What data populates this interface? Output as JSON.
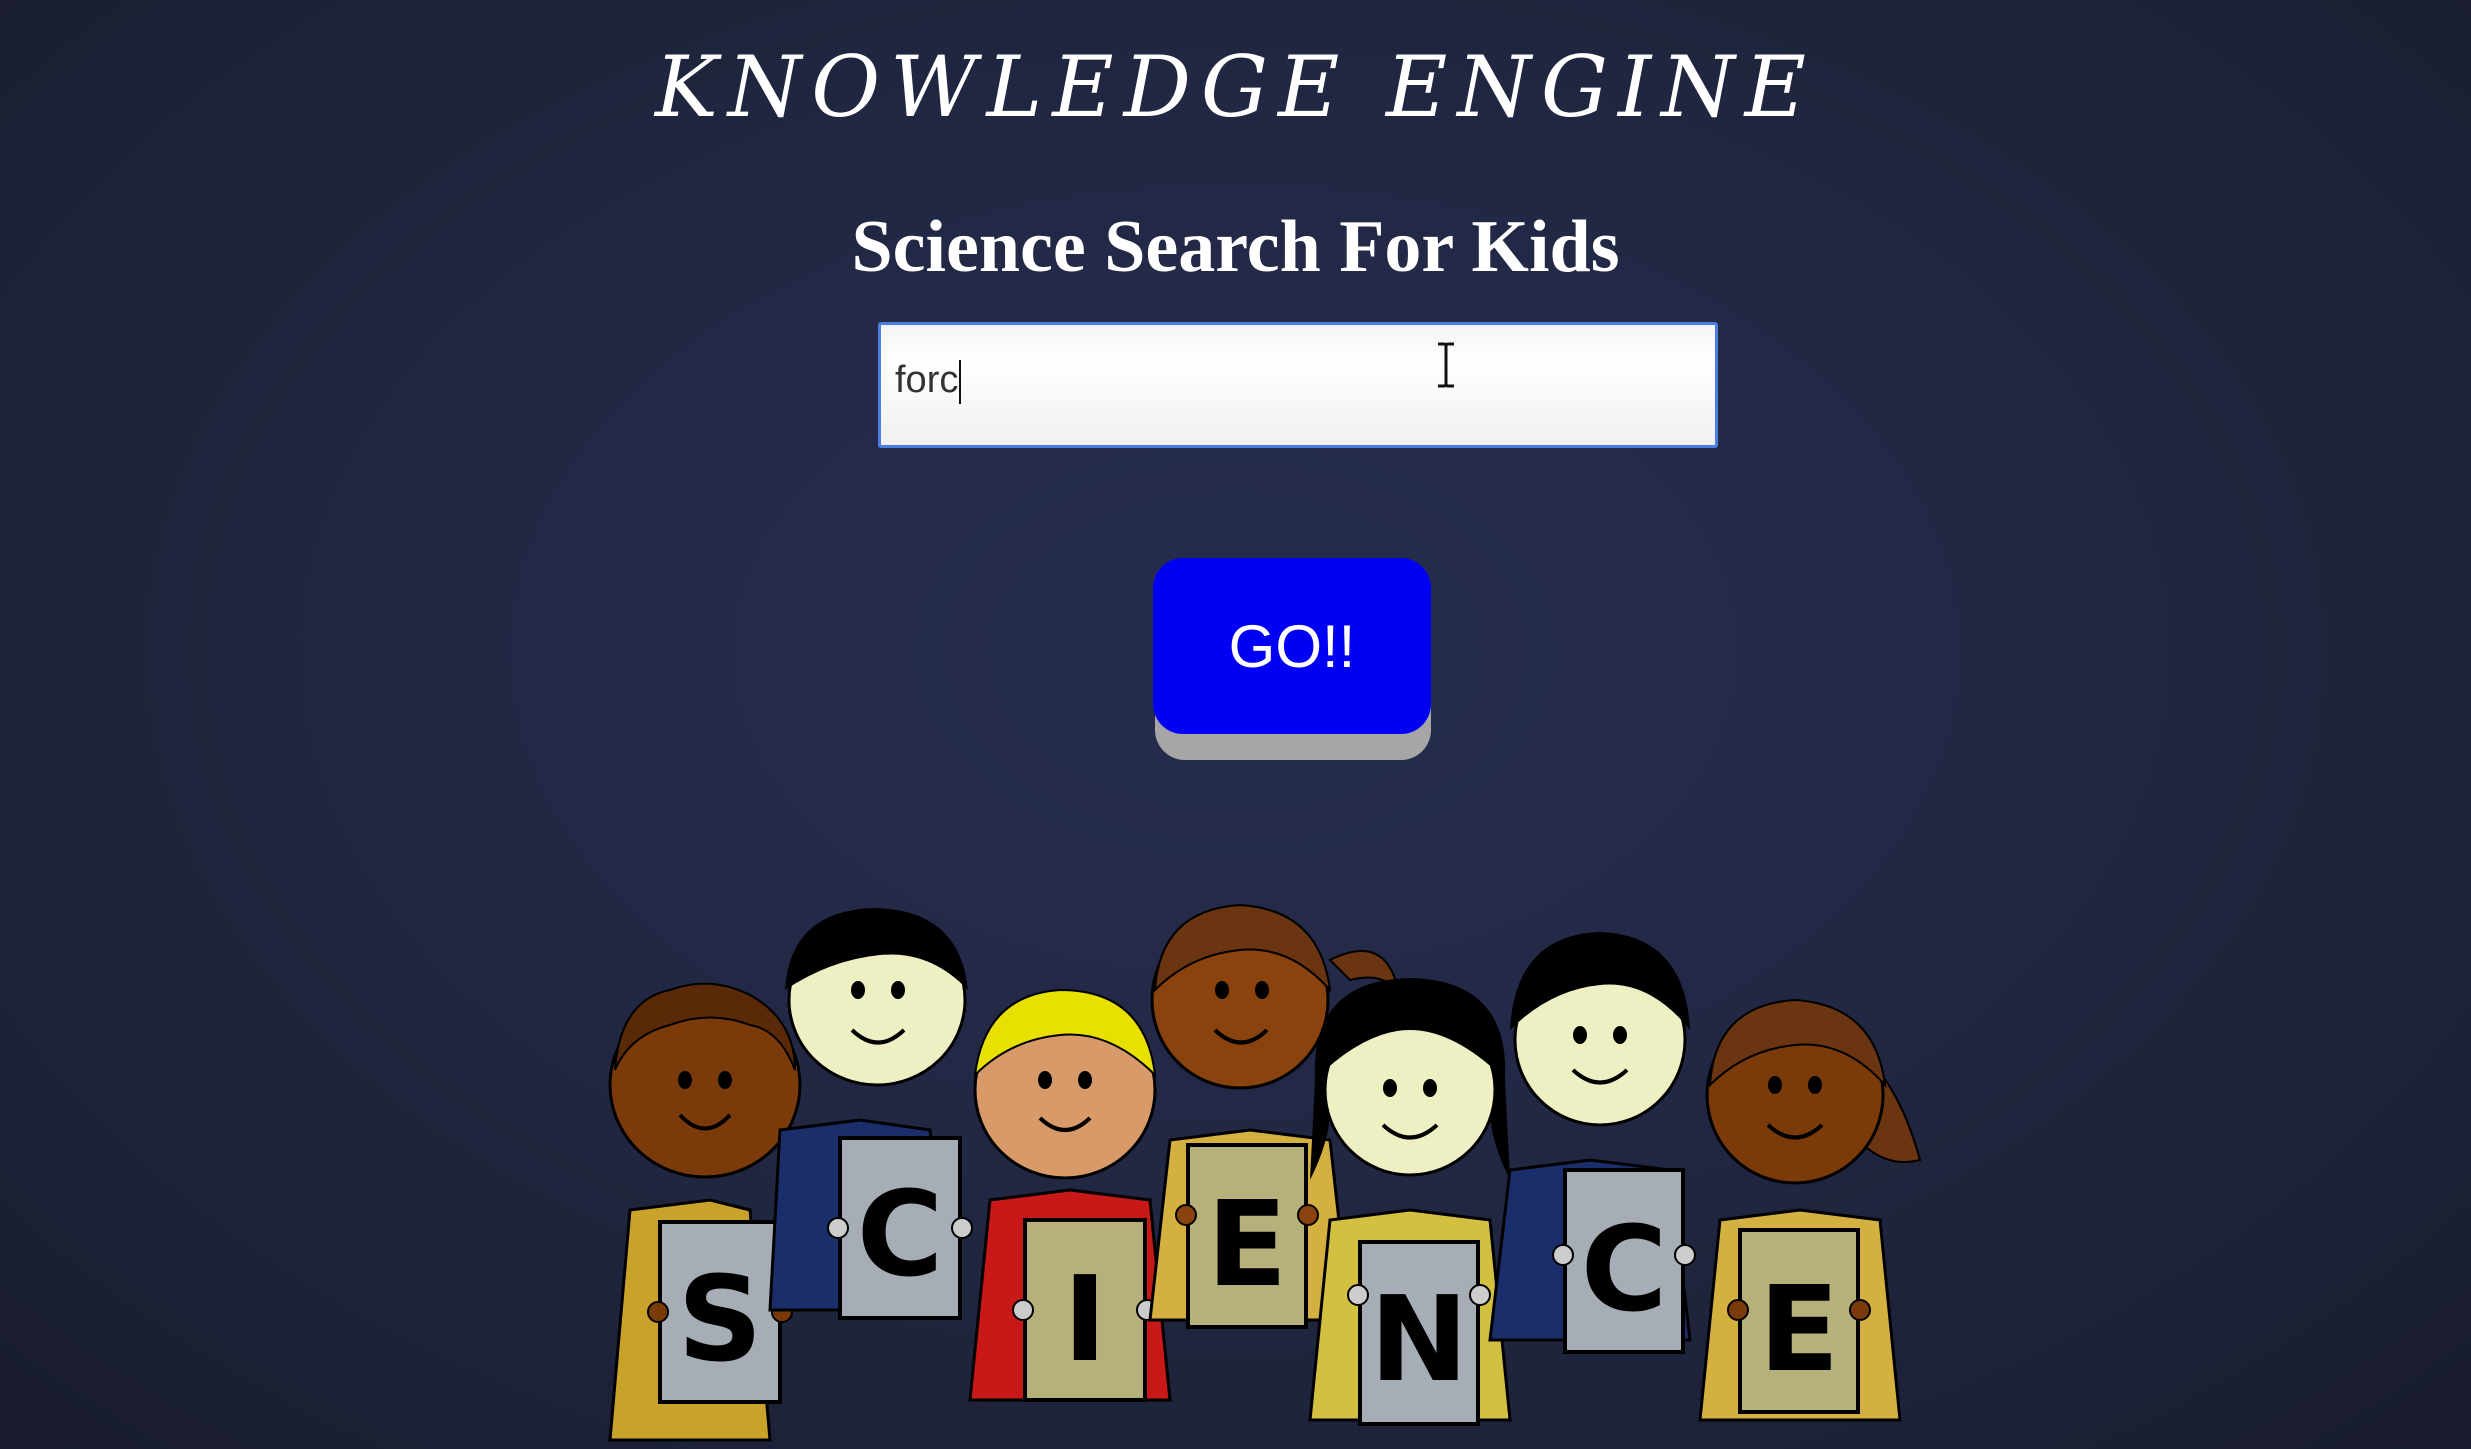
{
  "header": {
    "title": "KNOWLEDGE ENGINE",
    "subtitle": "Science Search For Kids"
  },
  "search": {
    "value": "forc"
  },
  "go_button": {
    "label": "GO!!"
  },
  "illustration": {
    "letters": [
      "S",
      "C",
      "I",
      "E",
      "N",
      "C",
      "E"
    ]
  },
  "colors": {
    "background": "#222844",
    "button": "#0000f5",
    "button_shadow": "#a6a6a6",
    "input_border": "#4a7fe0"
  }
}
